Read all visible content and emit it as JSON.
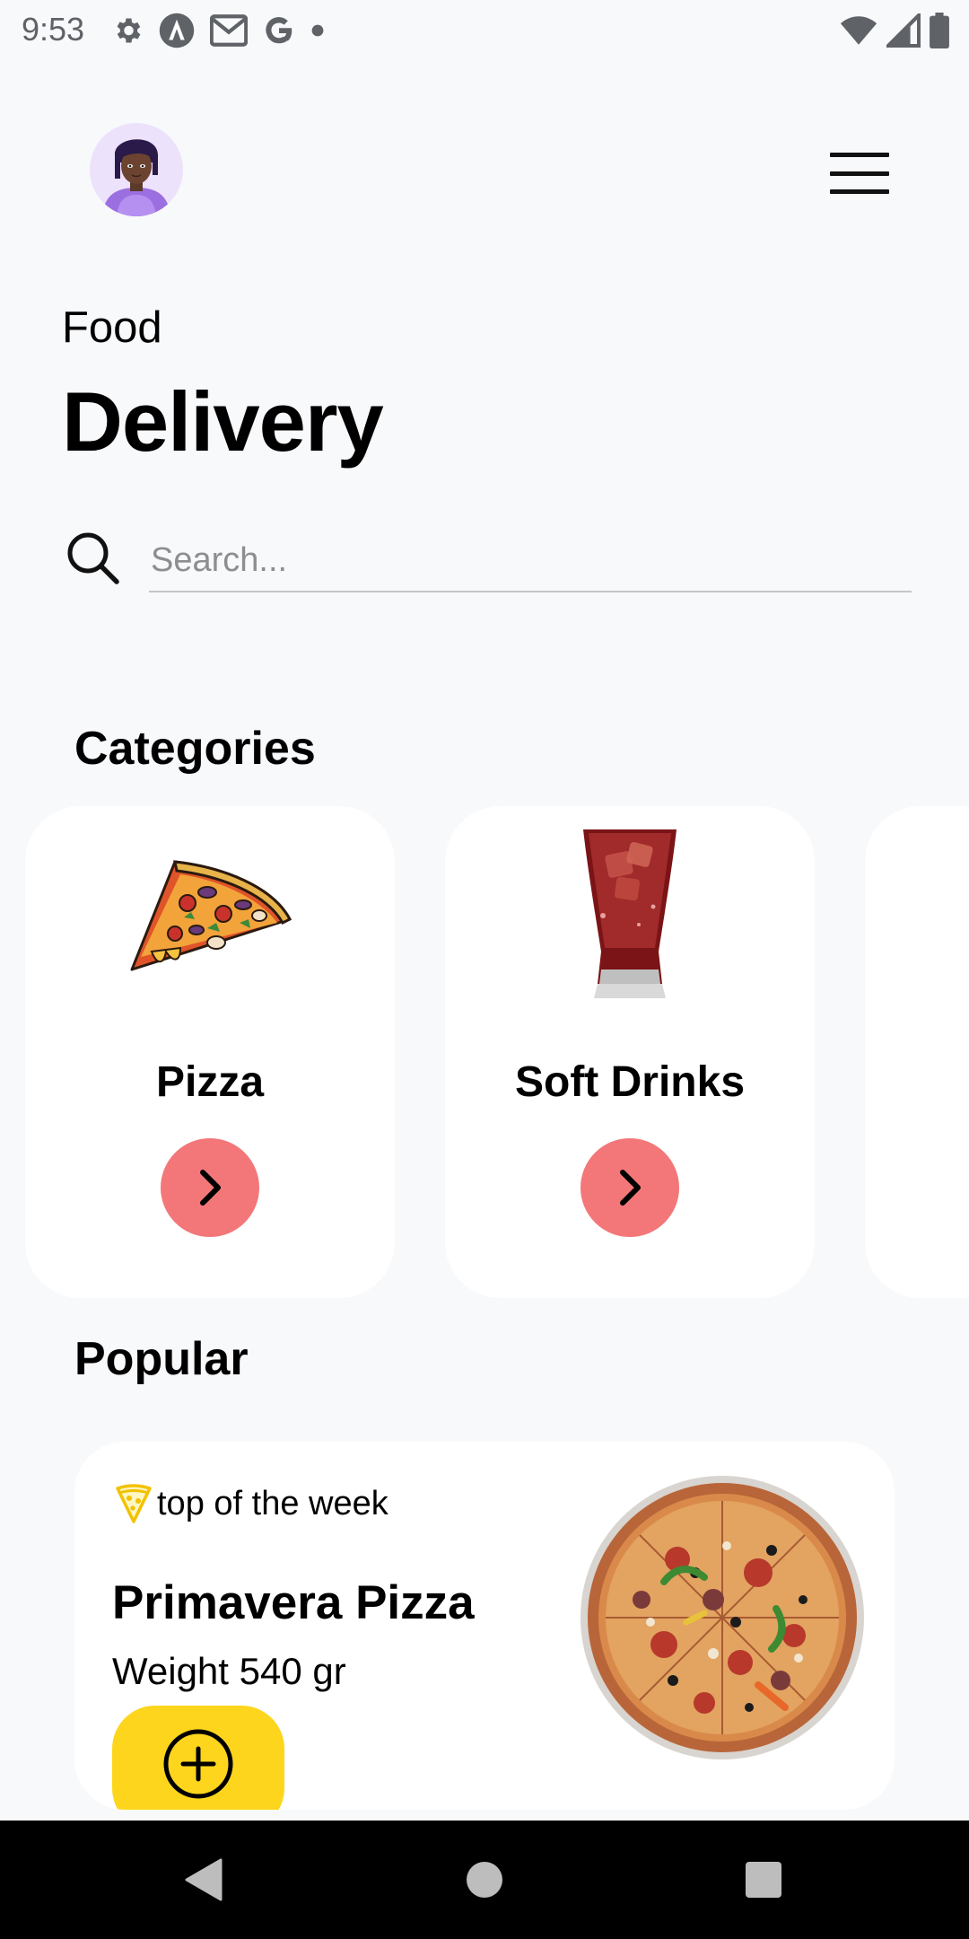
{
  "status_bar": {
    "time": "9:53",
    "left_icons": [
      "settings-gear-icon",
      "android-auto-icon",
      "gmail-icon",
      "google-icon",
      "notification-dot-icon"
    ],
    "right_icons": [
      "wifi-icon",
      "cell-signal-icon",
      "battery-icon"
    ]
  },
  "header": {
    "avatar": "user-avatar",
    "menu_icon": "hamburger-menu-icon"
  },
  "title": {
    "small": "Food",
    "large": "Delivery"
  },
  "search": {
    "placeholder": "Search...",
    "value": ""
  },
  "categories": {
    "title": "Categories",
    "items": [
      {
        "label": "Pizza",
        "icon": "pizza-slice-icon"
      },
      {
        "label": "Soft Drinks",
        "icon": "soft-drink-glass-icon"
      },
      {
        "label": "",
        "icon": ""
      }
    ]
  },
  "popular": {
    "title": "Popular",
    "items": [
      {
        "tag": "top of the week",
        "tag_icon": "pizza-slice-outline-icon",
        "name": "Primavera Pizza",
        "weight": "Weight 540 gr",
        "image": "pizza-photo"
      }
    ]
  },
  "nav_bar": {
    "buttons": [
      "back-icon",
      "home-icon",
      "recents-icon"
    ]
  },
  "colors": {
    "background": "#f8f9fb",
    "card": "#ffffff",
    "arrow_button": "#f37779",
    "add_button": "#fdd51c",
    "avatar_bg": "#ede2fb"
  }
}
